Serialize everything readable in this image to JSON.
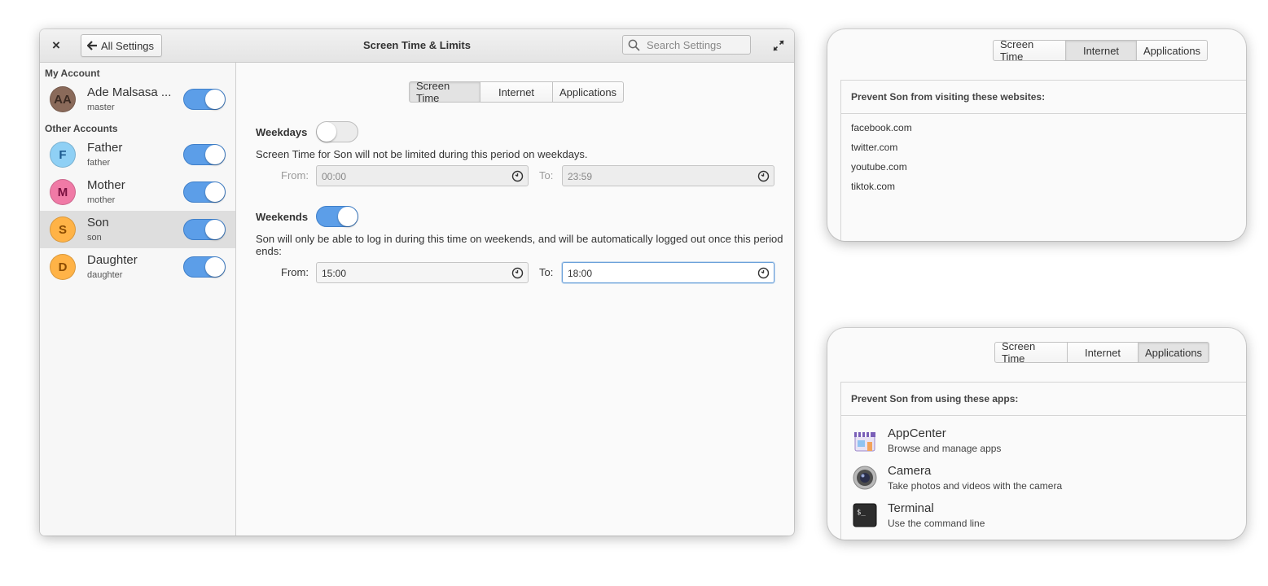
{
  "main": {
    "title": "Screen Time & Limits",
    "close_glyph": "×",
    "back_label": "All Settings",
    "back_arrow": "🡐",
    "search_placeholder": "Search Settings",
    "sidebar": {
      "my_account_header": "My Account",
      "other_accounts_header": "Other Accounts",
      "my_account": {
        "initials": "AA",
        "name": "Ade Malsasa ...",
        "username": "master",
        "enabled": true,
        "color": "#8a6a5a"
      },
      "accounts": [
        {
          "initials": "F",
          "name": "Father",
          "username": "father",
          "enabled": true,
          "color": "#8fd0f5",
          "text_color": "#1c5a8f"
        },
        {
          "initials": "M",
          "name": "Mother",
          "username": "mother",
          "enabled": true,
          "color": "#f07aa6",
          "text_color": "#7a1040"
        },
        {
          "initials": "S",
          "name": "Son",
          "username": "son",
          "enabled": true,
          "color": "#ffb347",
          "text_color": "#8a4a00"
        },
        {
          "initials": "D",
          "name": "Daughter",
          "username": "daughter",
          "enabled": true,
          "color": "#ffb347",
          "text_color": "#8a4a00"
        }
      ],
      "selected": "Son"
    },
    "tabs": [
      "Screen Time",
      "Internet",
      "Applications"
    ],
    "active_tab": "Screen Time",
    "weekdays": {
      "label": "Weekdays",
      "enabled": false,
      "description": "Screen Time for Son will not be limited during this period on weekdays.",
      "from_label": "From:",
      "from_value": "00:00",
      "to_label": "To:",
      "to_value": "23:59"
    },
    "weekends": {
      "label": "Weekends",
      "enabled": true,
      "description_line1": "Son will only be able to log in during this time on weekends, and will be automatically logged out once this period",
      "description_line2": "ends:",
      "from_label": "From:",
      "from_value": "15:00",
      "to_label": "To:",
      "to_value": "18:00"
    }
  },
  "internet_panel": {
    "tabs": [
      "Screen Time",
      "Internet",
      "Applications"
    ],
    "active_tab": "Internet",
    "header": "Prevent Son from visiting these websites:",
    "sites": [
      "facebook.com",
      "twitter.com",
      "youtube.com",
      "tiktok.com"
    ]
  },
  "apps_panel": {
    "tabs": [
      "Screen Time",
      "Internet",
      "Applications"
    ],
    "active_tab": "Applications",
    "header": "Prevent Son from using these apps:",
    "apps": [
      {
        "name": "AppCenter",
        "description": "Browse and manage apps",
        "icon": "appcenter-icon"
      },
      {
        "name": "Camera",
        "description": "Take photos and videos with the camera",
        "icon": "camera-icon"
      },
      {
        "name": "Terminal",
        "description": "Use the command line",
        "icon": "terminal-icon"
      }
    ]
  },
  "colors": {
    "accent": "#5c9ee8",
    "selected_row": "#dedede",
    "focus": "#6aa0da"
  }
}
